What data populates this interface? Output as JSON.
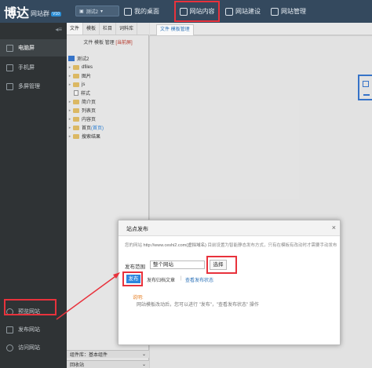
{
  "topbar": {
    "logo_main": "博达",
    "logo_sub": "网站群",
    "logo_tag": "V10",
    "site_select": "测试2",
    "nav": {
      "desktop": "我的桌面",
      "content": "网站内容",
      "build": "网站建设",
      "manage": "网站管理"
    }
  },
  "sidebar": {
    "collapse": "◂≡",
    "items": [
      {
        "label": "电脑屏",
        "icon": "monitor-icon"
      },
      {
        "label": "手机屏",
        "icon": "phone-icon"
      },
      {
        "label": "多屏管理",
        "icon": "multiscreen-icon"
      }
    ],
    "bottom_items": [
      {
        "label": "预览网站",
        "icon": "preview-icon"
      },
      {
        "label": "发布网站",
        "icon": "publish-icon"
      },
      {
        "label": "访问网站",
        "icon": "visit-icon"
      }
    ]
  },
  "tree": {
    "tabs": [
      "文件",
      "模板",
      "栏目",
      "词料库"
    ],
    "subtitle": "文件 模板 管理",
    "subtitle_current": "[当前屏]",
    "root": "测试2",
    "items": [
      {
        "label": "dfiles",
        "type": "folder"
      },
      {
        "label": "图片",
        "type": "folder"
      },
      {
        "label": "js",
        "type": "folder"
      },
      {
        "label": "样式",
        "type": "file"
      },
      {
        "label": "简介页",
        "type": "folder"
      },
      {
        "label": "列表页",
        "type": "folder"
      },
      {
        "label": "内容页",
        "type": "folder"
      },
      {
        "label": "首页",
        "type": "folder",
        "badge": "(首页)"
      },
      {
        "label": "搜索结果",
        "type": "folder"
      }
    ],
    "bottom_label": "组件库：基本组件",
    "bottom2_label": "回收站"
  },
  "main": {
    "tab": "文件 模板管理"
  },
  "dialog": {
    "title": "站点发布",
    "close": "×",
    "info_prefix": "您的网站",
    "info_url": "http://www.ceshi2.com(虚拟域名)",
    "info_rest": "目前设置为智能静态发布方式，只有在模板有改动时才需要手动发布",
    "range_label": "发布范围",
    "range_value": "整个网站",
    "select_button": "选择",
    "publish_button": "发布",
    "archive_link": "发布归档文章",
    "separator": "|",
    "status_link": "查看发布状态",
    "tip_label": "说明:",
    "tip_text": "网站模板改动后，您可以进行 \"发布\"，\"查看发布状态\" 操作"
  },
  "colors": {
    "topbar": "#34495e",
    "sidebar": "#2f3335",
    "highlight": "#e8323c",
    "accent": "#2e86de"
  }
}
